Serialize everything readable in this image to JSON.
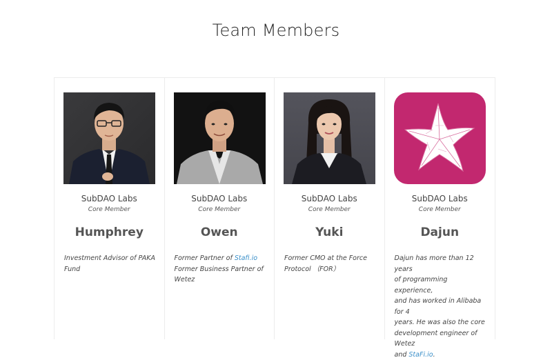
{
  "page": {
    "title": "Team Members"
  },
  "colors": {
    "link": "#3a8fc9",
    "logo_bg": "#c2286f"
  },
  "members": [
    {
      "org": "SubDAO Labs",
      "role": "Core Member",
      "name": "Humphrey",
      "bio_line1": "Investment Advisor of PAKA",
      "bio_line2": "Fund"
    },
    {
      "org": "SubDAO Labs",
      "role": "Core Member",
      "name": "Owen",
      "bio_prefix": "Former Partner of ",
      "bio_link": "Stafi.io",
      "bio_line2": "Former Business Partner of",
      "bio_line3": "Wetez"
    },
    {
      "org": "SubDAO Labs",
      "role": "Core Member",
      "name": "Yuki",
      "bio_line1": "Former CMO at the Force",
      "bio_line2": "Protocol （FOR）"
    },
    {
      "org": "SubDAO Labs",
      "role": "Core Member",
      "name": "Dajun",
      "bio_line1": "Dajun has more than 12 years",
      "bio_line2": "of programming experience,",
      "bio_line3": "and has worked in Alibaba for 4",
      "bio_line4": "years. He was also the core",
      "bio_line5": "development engineer of Wetez",
      "bio_line6_prefix": "and ",
      "bio_line6_link": "StaFi.io",
      "bio_line6_suffix": "."
    }
  ]
}
